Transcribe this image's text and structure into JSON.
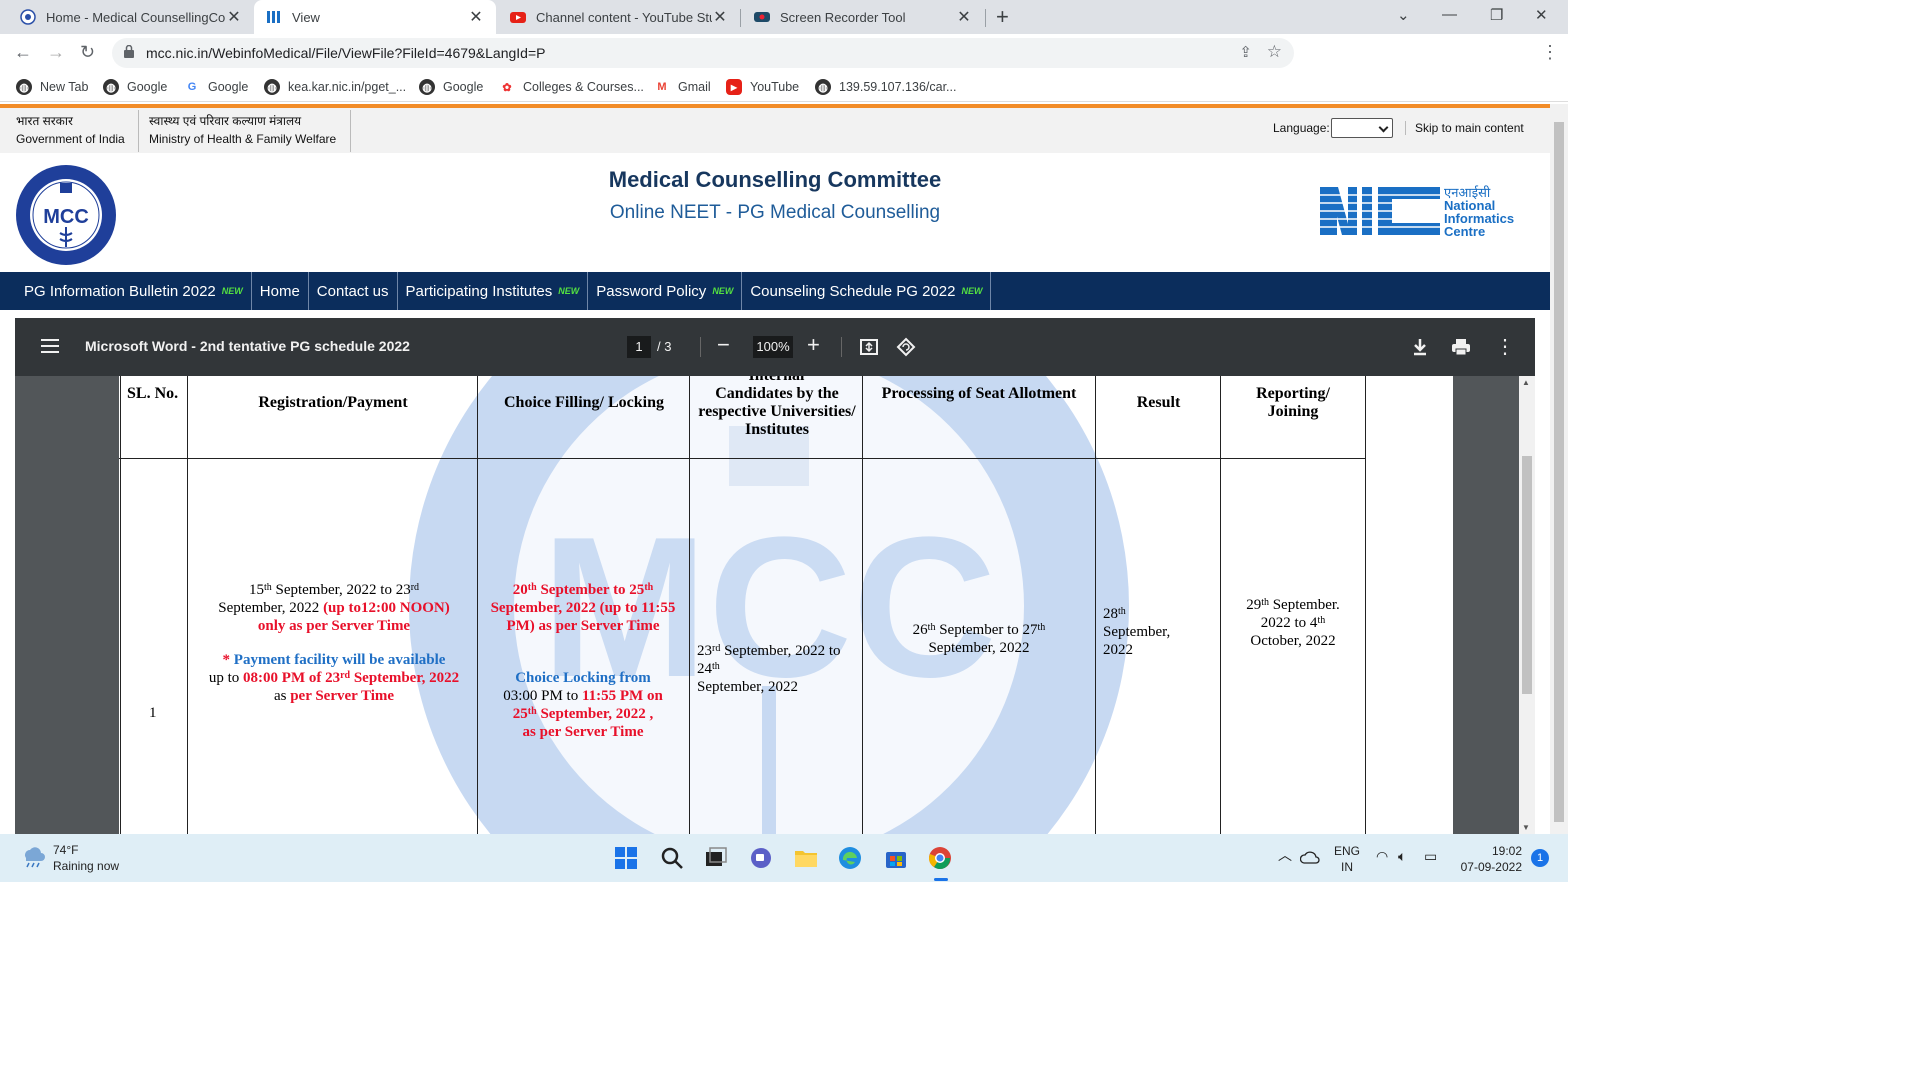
{
  "browser": {
    "tabs": [
      {
        "title": "Home - Medical CounsellingCom",
        "active": false
      },
      {
        "title": "View",
        "active": true
      },
      {
        "title": "Channel content - YouTube Studi",
        "active": false
      },
      {
        "title": "Screen Recorder Tool",
        "active": false
      }
    ],
    "url": "mcc.nic.in/WebinfoMedical/File/ViewFile?FileId=4679&LangId=P",
    "bookmarks": [
      "New Tab",
      "Google",
      "Google",
      "kea.kar.nic.in/pget_...",
      "Google",
      "Colleges & Courses...",
      "Gmail",
      "YouTube",
      "139.59.107.136/car..."
    ]
  },
  "goi": {
    "hindi_gov": "भारत सरकार",
    "english_gov": "Government of India",
    "hindi_ministry": "स्वास्थ्य एवं परिवार कल्याण मंत्रालय",
    "english_ministry": "Ministry of Health & Family Welfare",
    "language_label": "Language:",
    "skip_link": "Skip to main content"
  },
  "header": {
    "title": "Medical Counselling Committee",
    "subtitle": "Online NEET - PG Medical Counselling",
    "mcc_logo_text": "MCC",
    "nic_hindi": "एनआईसी",
    "nic_line1": "National",
    "nic_line2": "Informatics",
    "nic_line3": "Centre"
  },
  "nav": {
    "new_badge": "NEW",
    "items": [
      {
        "label": "PG Information Bulletin 2022",
        "new": true
      },
      {
        "label": "Home",
        "new": false
      },
      {
        "label": "Contact us",
        "new": false
      },
      {
        "label": "Participating Institutes",
        "new": true
      },
      {
        "label": "Password Policy",
        "new": true
      },
      {
        "label": "Counseling Schedule PG 2022",
        "new": true
      }
    ]
  },
  "pdf": {
    "title": "Microsoft Word - 2nd tentative PG schedule 2022",
    "page_current": "1",
    "page_total": "/  3",
    "zoom": "100%"
  },
  "table": {
    "headers": {
      "sl": "SL. No.",
      "registration": "Registration/Payment",
      "choice": "Choice Filling/ Locking",
      "internal_top": "Internal",
      "internal": "Candidates by the respective Universities/ Institutes",
      "processing": "Processing of Seat Allotment",
      "result": "Result",
      "reporting": "Reporting/ Joining"
    },
    "row": {
      "sl": "1",
      "reg_date_a": "15",
      "reg_sup_a": "th",
      "reg_date_b": " September, 2022 to 23",
      "reg_sup_b": "rd",
      "reg_date_c": "September, 2022",
      "reg_red_1": "(up to12:00 NOON)  only as per Server Time",
      "reg_pay_star": "* ",
      "reg_pay_blue": "Payment facility will be available",
      "reg_pay_upto": "up to",
      "reg_pay_red": "08:00 PM of 23",
      "reg_pay_sup": "rd",
      "reg_pay_red2": " September, 2022",
      "reg_pay_as": " as ",
      "reg_pay_red3": "per Server Time",
      "choice_a": "20",
      "choice_sup_a": "th",
      "choice_b": "  September  to 25",
      "choice_sup_b": "th",
      "choice_c": "September, 2022 (up to 11:55 PM) as per Server Time",
      "lock_blue": "Choice Locking from",
      "lock_black": "03:00 PM to",
      "lock_red": "11:55 PM on",
      "lock_d": "25",
      "lock_sup": "th",
      "lock_e": "  September, 2022  ,",
      "lock_f": "as per Server Time",
      "internal_a": "23",
      "internal_sup_a": "rd",
      "internal_b": " September, 2022 to 24",
      "internal_sup_b": "th",
      "internal_c": "September, 2022",
      "proc_a": "26",
      "proc_sup_a": "th",
      "proc_b": "  September to 27",
      "proc_sup_b": "th",
      "proc_c": "September, 2022",
      "result_a": "28",
      "result_sup": "th",
      "result_b": "September,",
      "result_c": "2022",
      "report_a": "29",
      "report_sup_a": "th",
      "report_b": " September.",
      "report_c": "2022 to 4",
      "report_sup_b": "th",
      "report_d": "October, 2022"
    }
  },
  "taskbar": {
    "temp": "74°F",
    "weather": "Raining now",
    "lang1": "ENG",
    "lang2": "IN",
    "time": "19:02",
    "date": "07-09-2022",
    "notif": "1"
  },
  "colors": {
    "nav_bg": "#0b2d5c",
    "title": "#17375e",
    "subtitle": "#1f5c99",
    "red_text": "#e8102a",
    "blue_text": "#1f6fc5",
    "orange_bar": "#f28c28"
  }
}
